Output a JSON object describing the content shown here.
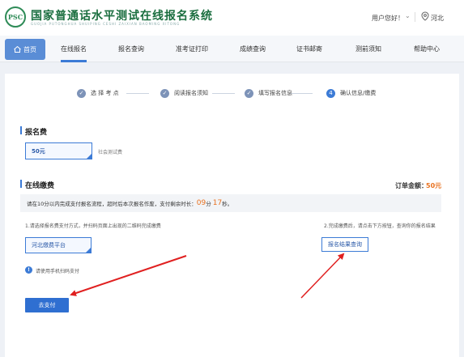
{
  "header": {
    "logo_text": "PSC",
    "title": "国家普通话水平测试在线报名系统",
    "subtitle": "GUOJIA PUTONGHUA SHUIPING CESHI ZAIXIAN BAOMING XITONG",
    "greeting": "用户您好！",
    "chevron": "⌄",
    "location": "河北"
  },
  "nav": {
    "items": [
      {
        "label": "首页"
      },
      {
        "label": "在线报名"
      },
      {
        "label": "报名查询"
      },
      {
        "label": "准考证打印"
      },
      {
        "label": "成绩查询"
      },
      {
        "label": "证书邮寄"
      },
      {
        "label": "测前须知"
      },
      {
        "label": "帮助中心"
      }
    ]
  },
  "steps": [
    {
      "num": "✓",
      "label": "选 择 考 点"
    },
    {
      "num": "✓",
      "label": "阅读报名须知"
    },
    {
      "num": "✓",
      "label": "填写报名信息"
    },
    {
      "num": "4",
      "label": "确认信息/缴费"
    }
  ],
  "fee_section": {
    "title": "报名费",
    "amount": "50元",
    "note": "社会测试费"
  },
  "payment_section": {
    "title": "在线缴费",
    "order_label": "订单金额：",
    "order_value": "50元",
    "notice_prefix": "请在10分以内完成支付报名流程，超时后本次报名作废，支付剩余时长：",
    "minutes": "09",
    "min_unit": "分",
    "seconds": "17",
    "sec_unit": "秒。",
    "left_instruction": "1.请选择报名费支付方式，并扫码页面上出现的二维码完成缴费",
    "right_instruction": "2.完成缴费后，请点击下方按钮，查询你的报名结果",
    "platform": "河北缴费平台",
    "result_button": "报名结果查询",
    "info_text": "请使用手机扫码支付",
    "pay_button": "去支付"
  },
  "colors": {
    "accent": "#3c7bd6",
    "orange": "#e8711f",
    "arrow": "#e02020",
    "brand_green": "#1a6e3f"
  }
}
